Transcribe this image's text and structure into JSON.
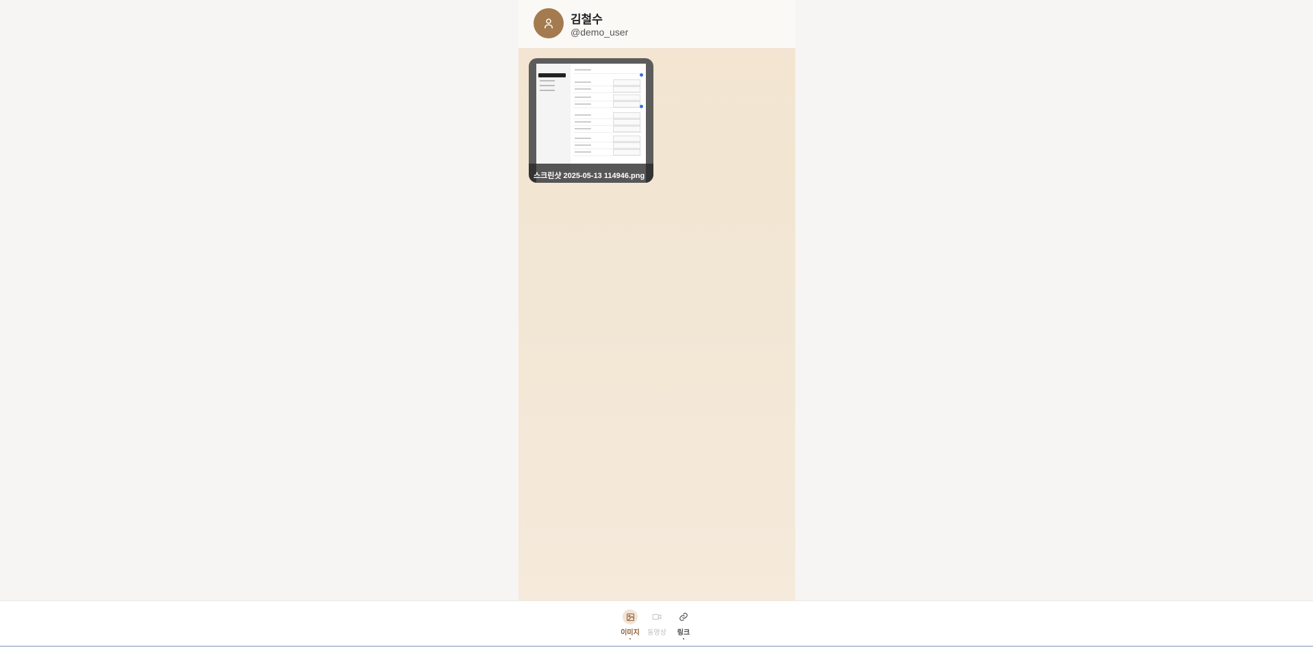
{
  "profile": {
    "name": "김철수",
    "handle": "@demo_user",
    "avatar_icon": "user-icon",
    "avatar_color": "#a47a4f"
  },
  "gallery": {
    "items": [
      {
        "caption": "스크린샷 2025-05-13 114946.png",
        "type": "image"
      }
    ]
  },
  "bottom_nav": {
    "tabs": [
      {
        "label": "이미지",
        "icon": "image-icon",
        "active": true
      },
      {
        "label": "동영상",
        "icon": "video-icon",
        "active": false,
        "disabled": true
      },
      {
        "label": "링크",
        "icon": "link-icon",
        "active": false
      }
    ]
  },
  "colors": {
    "accent": "#8b5a35",
    "column_bg": "#f3e5d0",
    "page_bg": "#f6f5f3"
  }
}
